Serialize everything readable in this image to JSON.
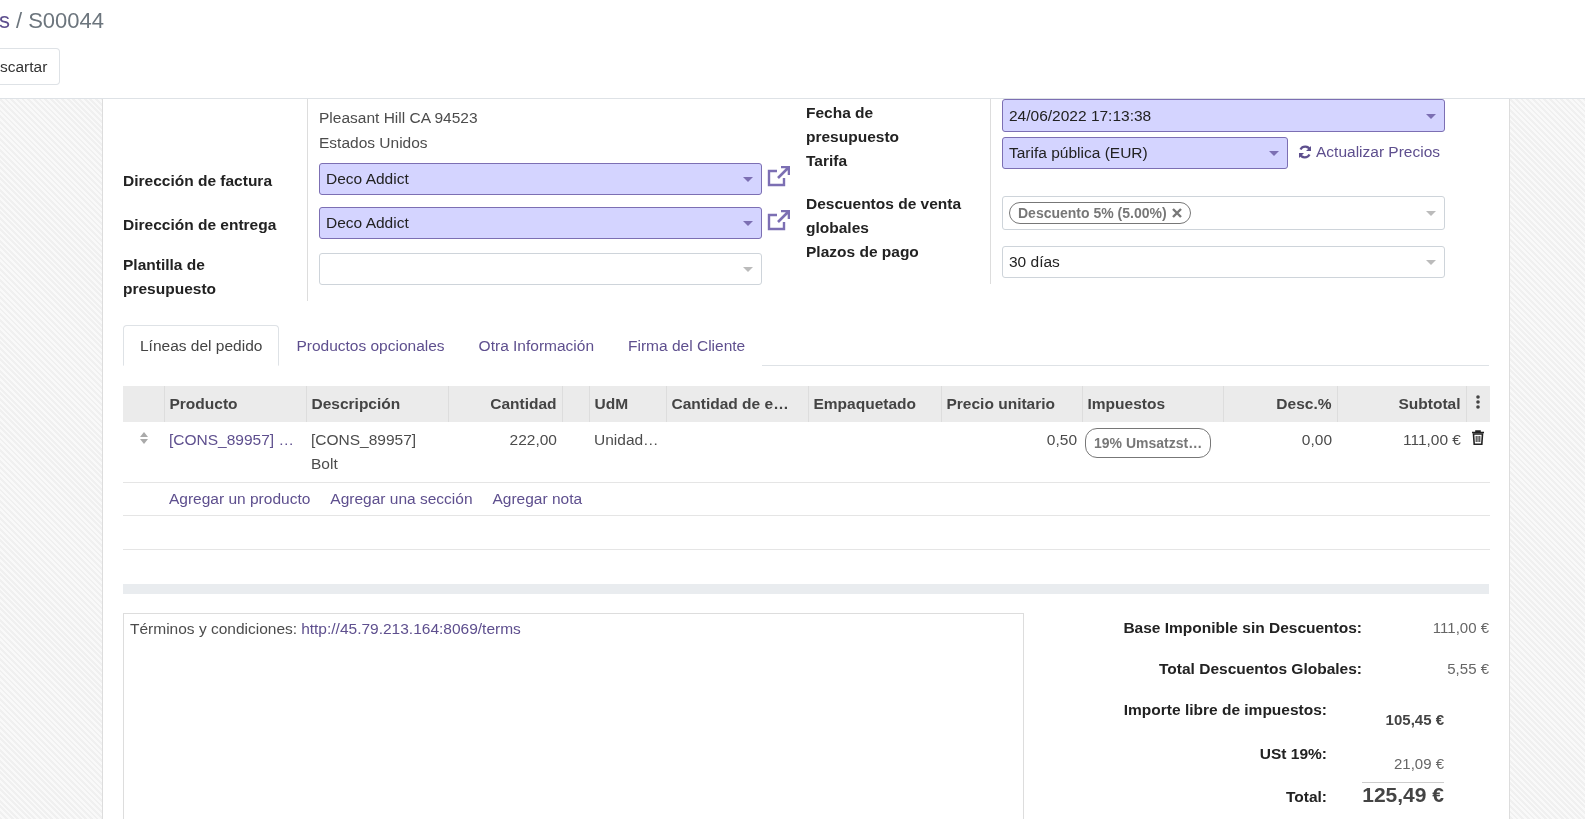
{
  "breadcrumb": {
    "parent": "s",
    "separator": "/",
    "current": "S00044"
  },
  "buttons": [
    {
      "label": "scartar"
    }
  ],
  "address_lines": [
    "Pleasant Hill CA 94523",
    "Estados Unidos"
  ],
  "left_fields": [
    {
      "label": "Dirección de factura",
      "value": "Deco Addict",
      "required": true,
      "external_link": true
    },
    {
      "label": "Dirección de entrega",
      "value": "Deco Addict",
      "required": true,
      "external_link": true
    },
    {
      "label": "Plantilla de presupuesto",
      "required": false
    }
  ],
  "right_fields": [
    {
      "label": "Fecha de presupuesto",
      "value": "24/06/2022 17:13:38",
      "kind": "select",
      "required": true
    },
    {
      "label": "Tarifa",
      "value": "Tarifa pública (EUR)",
      "kind": "select",
      "required": true,
      "action": "Actualizar Precios"
    },
    {
      "label": "Descuentos de venta globales",
      "kind": "tags",
      "required": false,
      "tags": [
        "Descuento 5% (5.00%)"
      ]
    },
    {
      "label": "Plazos de pago",
      "value": "30 días",
      "kind": "select",
      "required": false
    }
  ],
  "tabs": [
    {
      "label": "Líneas del pedido",
      "selected": true
    },
    {
      "label": "Productos opcionales",
      "selected": false
    },
    {
      "label": "Otra Información",
      "selected": false
    },
    {
      "label": "Firma del Cliente",
      "selected": false
    }
  ],
  "table": {
    "columns": [
      {
        "kind": "text",
        "label": "Producto"
      },
      {
        "kind": "text",
        "label": "Descripción"
      },
      {
        "kind": "text",
        "label": "Cantidad"
      },
      {
        "kind": "spacer"
      },
      {
        "kind": "text",
        "label": "UdM"
      },
      {
        "kind": "text",
        "label": "Cantidad de e…"
      },
      {
        "kind": "text",
        "label": "Empaquetado"
      },
      {
        "kind": "text",
        "label": "Precio unitario"
      },
      {
        "kind": "text",
        "label": "Impuestos"
      },
      {
        "kind": "text",
        "label": "Desc.%"
      },
      {
        "kind": "text",
        "label": "Subtotal"
      }
    ],
    "rows": [
      {
        "product": "[CONS_89957] …",
        "description": "[CONS_89957] Bolt",
        "quantity": "222,00",
        "uom": "Unidad…",
        "unit_price": "0,50",
        "taxes": [
          "19% Umsatzst…"
        ],
        "discount": "0,00",
        "subtotal": "111,00 €"
      }
    ],
    "add_links": [
      "Agregar un producto",
      "Agregar una sección",
      "Agregar nota"
    ]
  },
  "notes": {
    "text": "Términos y condiciones:",
    "link": "http://45.79.213.164:8069/terms"
  },
  "totals": [
    {
      "label": "Base Imponible sin Descuentos:",
      "value": "111,00 €",
      "kind": "discount_line"
    },
    {
      "label": "Total Descuentos Globales:",
      "value": "5,55 €",
      "kind": "discount_line"
    },
    {
      "label": "Importe libre de impuestos:",
      "value": "105,45 €",
      "kind": "untaxed"
    },
    {
      "label": "USt 19%:",
      "value": "21,09 €",
      "kind": "tax"
    },
    {
      "label": "Total:",
      "value": "125,49 €",
      "kind": "total"
    }
  ]
}
